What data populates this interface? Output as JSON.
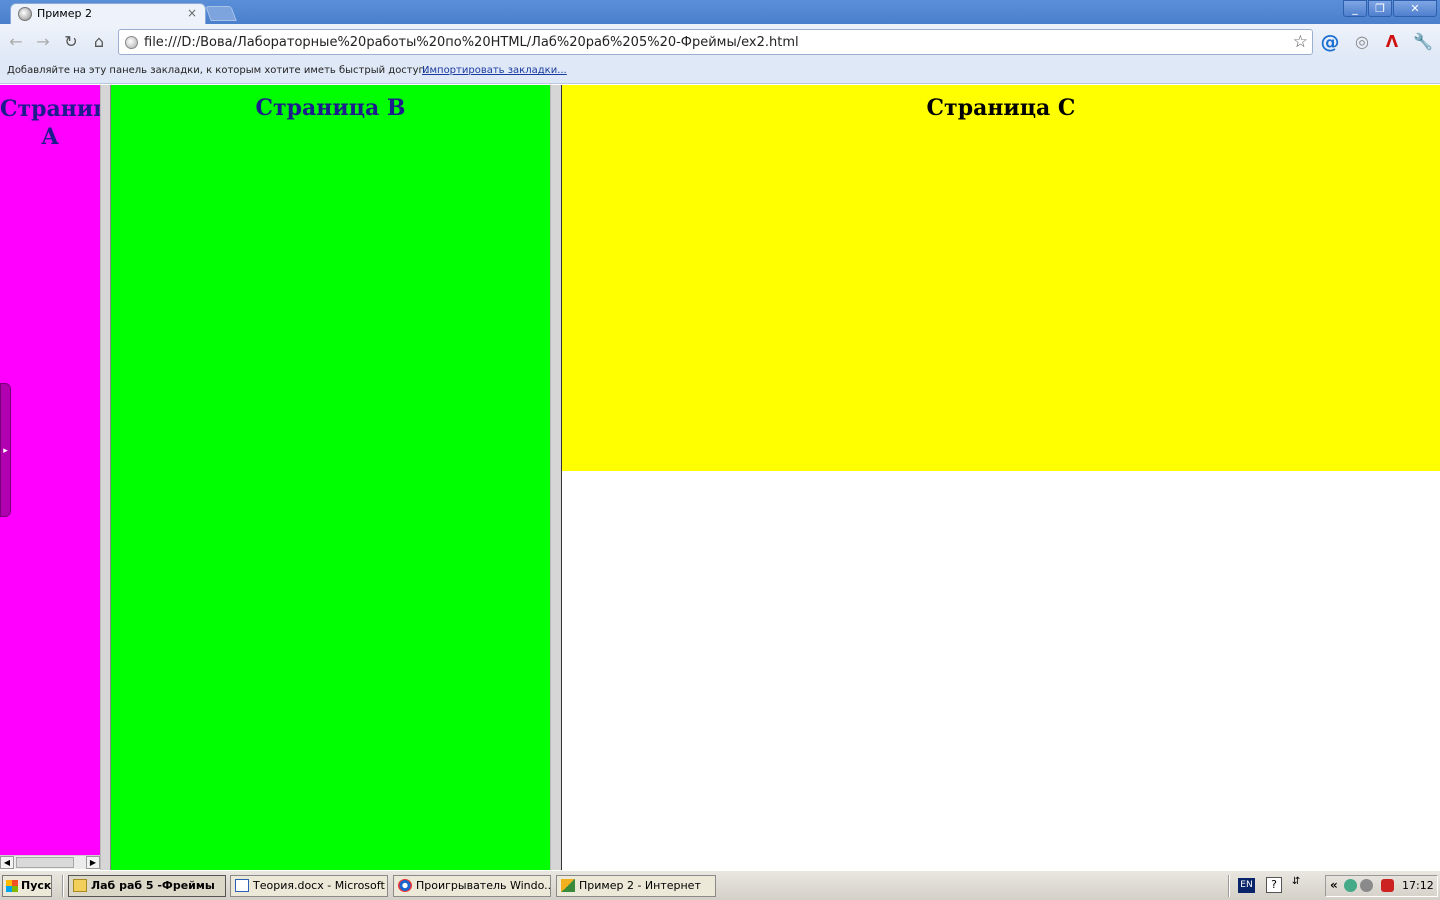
{
  "browser": {
    "tab_title": "Пример 2",
    "tab_close": "×",
    "url": "file:///D:/Вова/Лабораторные%20работы%20по%20HTML/Лаб%20раб%205%20-Фреймы/ex2.html",
    "bookmarks_hint": "Добавляйте на эту панель закладки, к которым хотите иметь быстрый доступ.",
    "bookmarks_import": "Импортировать закладки..."
  },
  "frames": {
    "a_heading": "Страница A",
    "b_heading": "Страница B",
    "c_heading": "Страница C",
    "colors": {
      "frame_a": "#ff00ff",
      "frame_b": "#00ff00",
      "frame_c": "#ffff00",
      "frame_d": "#ffffff",
      "heading_text": "#1c1c8c"
    }
  },
  "taskbar": {
    "start_label": "Пуск",
    "tasks": [
      {
        "label": "Лаб раб 5 -Фреймы",
        "active": true,
        "icon": "folder-icon"
      },
      {
        "label": "Теория.docx - Microsoft ...",
        "active": false,
        "icon": "word-icon"
      },
      {
        "label": "Проигрыватель Windo...",
        "active": false,
        "icon": "media-player-icon"
      },
      {
        "label": "Пример 2 - Интернет",
        "active": false,
        "icon": "browser-icon"
      }
    ],
    "lang": "EN",
    "help": "?",
    "clock": "17:12"
  }
}
